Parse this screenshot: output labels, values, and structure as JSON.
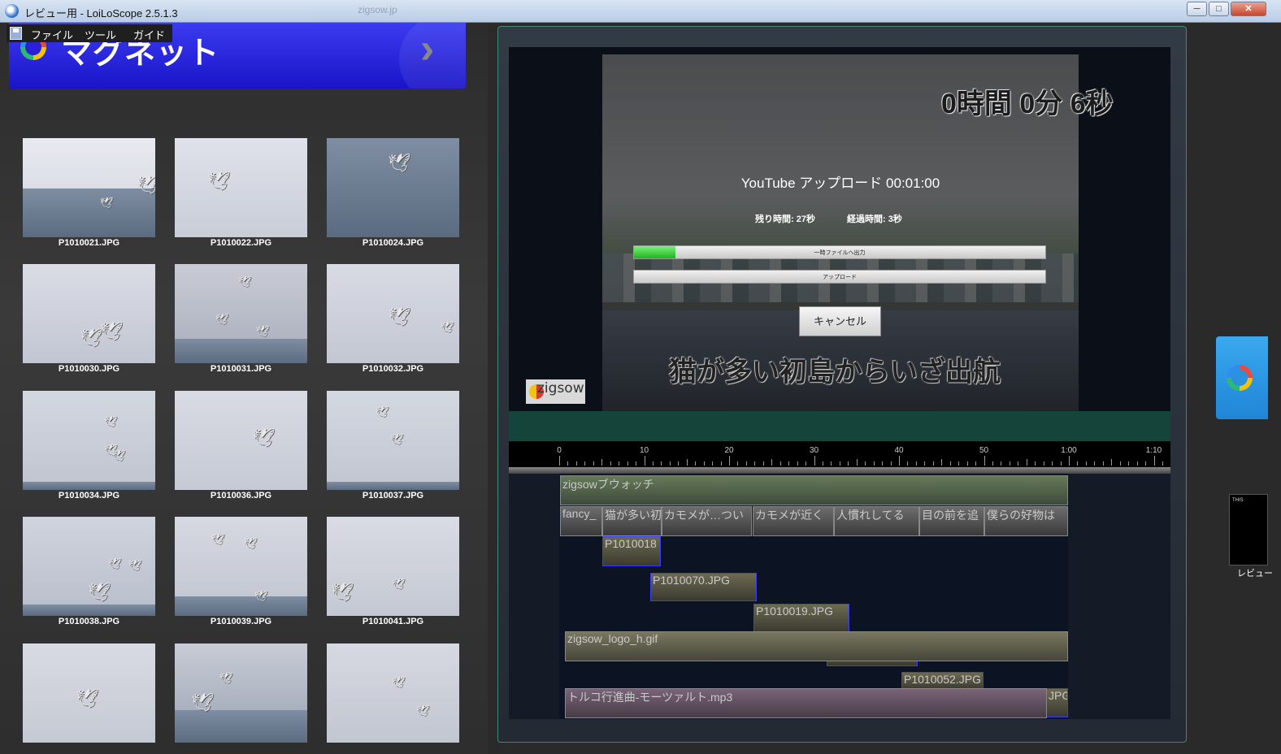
{
  "window": {
    "title": "レビュー用 - LoiLoScope 2.5.1.3",
    "background_text": "zigsow.jp",
    "buttons": [
      "─",
      "□",
      "✕"
    ]
  },
  "menu": [
    "ファイル",
    "ツール",
    "ガイド"
  ],
  "banner": {
    "title": "マグネット",
    "arrow": "›"
  },
  "thumbnails": [
    {
      "label": "P1010021.JPG"
    },
    {
      "label": "P1010022.JPG"
    },
    {
      "label": "P1010024.JPG"
    },
    {
      "label": "P1010030.JPG"
    },
    {
      "label": "P1010031.JPG"
    },
    {
      "label": "P1010032.JPG"
    },
    {
      "label": "P1010034.JPG"
    },
    {
      "label": "P1010036.JPG"
    },
    {
      "label": "P1010037.JPG"
    },
    {
      "label": "P1010038.JPG"
    },
    {
      "label": "P1010039.JPG"
    },
    {
      "label": "P1010041.JPG"
    },
    {
      "label": ""
    },
    {
      "label": ""
    },
    {
      "label": ""
    }
  ],
  "preview": {
    "timer": "0時間 0分 6秒",
    "upload_title": "YouTube アップロード  00:01:00",
    "remaining": "残り時間: 27秒",
    "elapsed": "経過時間: 3秒",
    "progress1_label": "一時ファイルへ出力",
    "progress1_fraction": 0.1,
    "progress2_label": "アップロード",
    "progress2_fraction": 0,
    "cancel": "キャンセル",
    "subtitle": "猫が多い初島からいざ出航",
    "logo": "zigsow"
  },
  "ruler": {
    "labels": [
      "0",
      "10",
      "20",
      "30",
      "40",
      "50",
      "1:00",
      "1:10"
    ]
  },
  "clips": [
    {
      "text": "zigsowブウォッチ",
      "type": "g"
    },
    {
      "text": "fancy_",
      "type": "grey"
    },
    {
      "text": "猫が多い初",
      "type": "grey"
    },
    {
      "text": "カモメが…つい",
      "type": "grey"
    },
    {
      "text": "カモメが近く",
      "type": "grey"
    },
    {
      "text": "人慣れしてる",
      "type": "grey"
    },
    {
      "text": "目の前を追",
      "type": "grey"
    },
    {
      "text": "僕らの好物は",
      "type": "grey"
    },
    {
      "text": "P1010018",
      "type": "img"
    },
    {
      "text": "P1010070.JPG",
      "type": "img"
    },
    {
      "text": "P1010019.JPG",
      "type": "img"
    },
    {
      "text": "",
      "type": "img"
    },
    {
      "text": "zigsow_logo_h.gif",
      "type": "gif"
    },
    {
      "text": "P1010052.JPG",
      "type": "img"
    },
    {
      "text": "JPG",
      "type": "img"
    },
    {
      "text": "トルコ行進曲-モーツァルト.mp3",
      "type": "mp3"
    }
  ],
  "side": {
    "mini_label": "レビュー",
    "mini_text": "THIS"
  }
}
